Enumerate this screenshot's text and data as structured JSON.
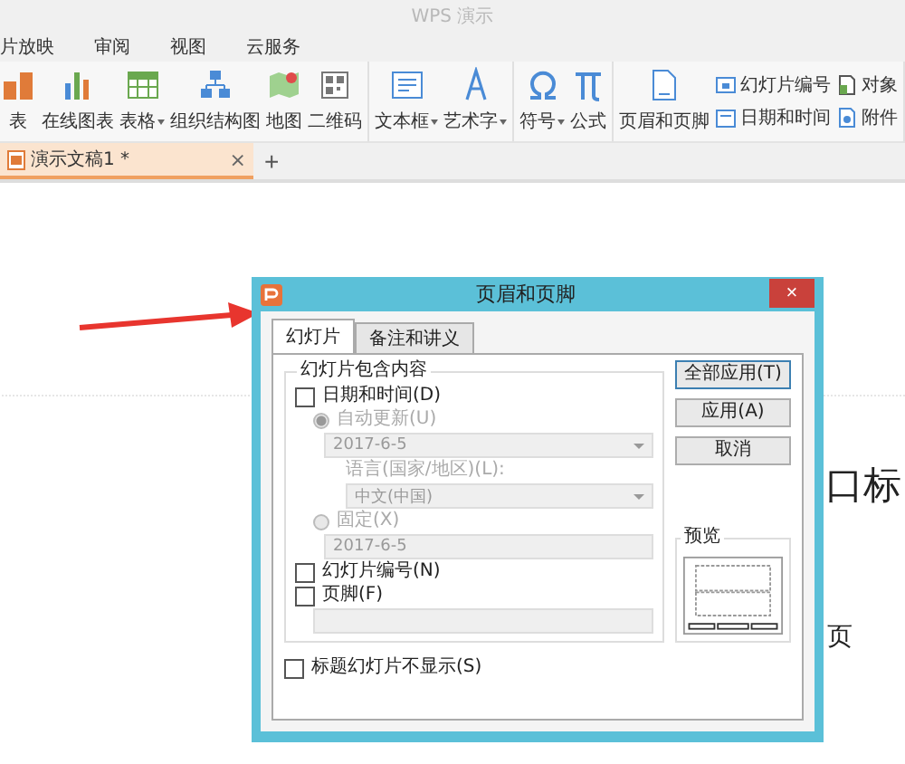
{
  "app_title": "WPS 演示",
  "menu": [
    {
      "label": "片放映"
    },
    {
      "label": "审阅"
    },
    {
      "label": "视图"
    },
    {
      "label": "云服务"
    }
  ],
  "toolbar_groups": [
    [
      {
        "kind": "large",
        "label": "表",
        "dropdown": false
      },
      {
        "kind": "large",
        "label": "在线图表",
        "dropdown": false
      },
      {
        "kind": "large",
        "label": "表格",
        "dropdown": true
      },
      {
        "kind": "large",
        "label": "组织结构图",
        "dropdown": false
      },
      {
        "kind": "large",
        "label": "地图",
        "dropdown": false
      },
      {
        "kind": "large",
        "label": "二维码",
        "dropdown": false
      }
    ],
    [
      {
        "kind": "large",
        "label": "文本框",
        "dropdown": true
      },
      {
        "kind": "large",
        "label": "艺术字",
        "dropdown": true
      }
    ],
    [
      {
        "kind": "large",
        "label": "符号",
        "dropdown": true
      },
      {
        "kind": "large",
        "label": "公式",
        "dropdown": false
      }
    ],
    [
      {
        "kind": "large",
        "label": "页眉和页脚",
        "dropdown": false
      },
      {
        "kind": "stack",
        "items": [
          {
            "label": "幻灯片编号"
          },
          {
            "label": "日期和时间"
          }
        ]
      },
      {
        "kind": "stack",
        "items": [
          {
            "label": "对象"
          },
          {
            "label": "附件"
          }
        ]
      }
    ]
  ],
  "doc_tab": {
    "label": "演示文稿1 *",
    "close": "×",
    "selected": true
  },
  "new_tab": "+",
  "slide_texts": [
    {
      "kind": "title",
      "text": "口标"
    },
    {
      "kind": "subtitle",
      "text": "页"
    }
  ],
  "dialog": {
    "title": "页眉和页脚",
    "close": "×",
    "tabs": [
      {
        "label": "幻灯片",
        "selected": true
      },
      {
        "label": "备注和讲义",
        "selected": false
      }
    ],
    "group_title": "幻灯片包含内容",
    "date_time": {
      "label": "日期和时间(D)",
      "checked": false
    },
    "auto_update": {
      "label": "自动更新(U)",
      "selected": true,
      "disabled": true
    },
    "date_format": {
      "value": "2017-6-5",
      "disabled": true
    },
    "language_label": "语言(国家/地区)(L):",
    "language": {
      "value": "中文(中国)",
      "disabled": true
    },
    "fixed": {
      "label": "固定(X)",
      "selected": false,
      "disabled": true
    },
    "fixed_value": {
      "value": "2017-6-5",
      "disabled": true
    },
    "slide_number": {
      "label": "幻灯片编号(N)",
      "checked": false
    },
    "footer": {
      "label": "页脚(F)",
      "checked": false
    },
    "hide_on_title": {
      "label": "标题幻灯片不显示(S)",
      "checked": false
    },
    "buttons": [
      {
        "label": "全部应用(T)",
        "default": true
      },
      {
        "label": "应用(A)",
        "default": false
      },
      {
        "label": "取消",
        "default": false
      }
    ],
    "preview_title": "预览"
  }
}
